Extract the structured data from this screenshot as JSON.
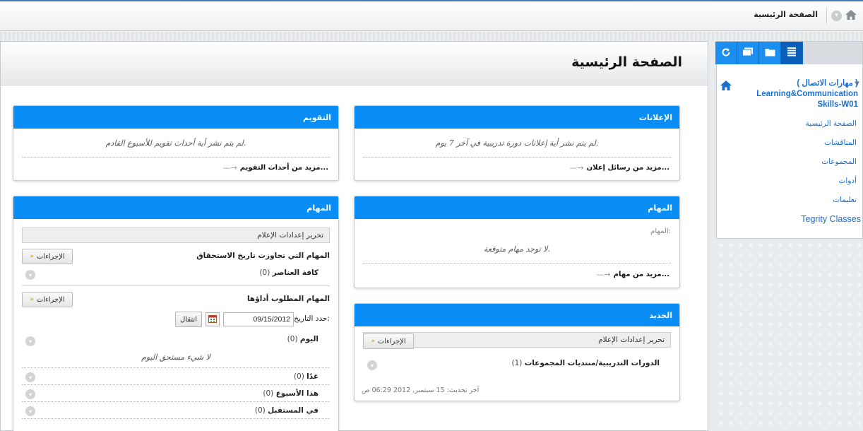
{
  "topbar": {
    "breadcrumb": "الصفحة الرئيسية",
    "home_icon": "home-icon",
    "dropdown_icon": "chevron-down-icon"
  },
  "page": {
    "title": "الصفحة الرئيسية"
  },
  "nav": {
    "tabs": [
      {
        "icon": "refresh-icon"
      },
      {
        "icon": "window-icon"
      },
      {
        "icon": "folder-icon"
      },
      {
        "icon": "list-icon"
      }
    ],
    "course_title": "( مهارات الاتصال ) Learning&Communication Skills-W01",
    "items": [
      {
        "label": "الصفحة الرئيسية"
      },
      {
        "label": "المناقشات"
      },
      {
        "label": "المجموعات"
      },
      {
        "label": "أدوات"
      },
      {
        "label": "تعليمات"
      },
      {
        "label": "Tegrity Classes"
      }
    ]
  },
  "announcements": {
    "title": "الإعلانات",
    "empty": "لم يتم نشر أية إعلانات دورة تدريبية في آخر 7 يوم.",
    "more": "مزيد من رسائل إعلان..."
  },
  "calendar": {
    "title": "التقويم",
    "empty": "لم يتم نشر أية أحداث تقويم للأسبوع القادم.",
    "more": "مزيد من أحداث التقويم..."
  },
  "tasks_right": {
    "title": "المهام",
    "label": "المهام:",
    "empty": "لا توجد مهام متوقعة.",
    "more": "مزيد من مهام..."
  },
  "whats_new": {
    "title": "الجديد",
    "edit_notifications": "تحرير إعدادات الإعلام",
    "actions": "الإجراءات",
    "item_label": "الدورات التدريبية/منتديات المجموعات",
    "item_count": "(1)",
    "updated": "آخر تحديث: 15 سبتمبر, 2012 06:29 ص"
  },
  "tasks_left": {
    "title": "المهام",
    "edit_notifications": "تحرير إعدادات الإعلام",
    "overdue_label": "المهام التي تجاوزت تاريخ الاستحقاق",
    "actions": "الإجراءات",
    "all_items": "كافة العناصر",
    "all_items_count": "(0)",
    "due_label": "المهام المطلوب أداؤها",
    "set_date_label": "حدد التاريخ:",
    "date_value": "09/15/2012",
    "go": "انتقال",
    "today": "اليوم",
    "today_count": "(0)",
    "nothing_due": "لا شيء مستحق اليوم",
    "tomorrow": "غدًا",
    "tomorrow_count": "(0)",
    "this_week": "هذا الأسبوع",
    "this_week_count": "(0)",
    "future": "في المستقبل",
    "future_count": "(0)"
  }
}
